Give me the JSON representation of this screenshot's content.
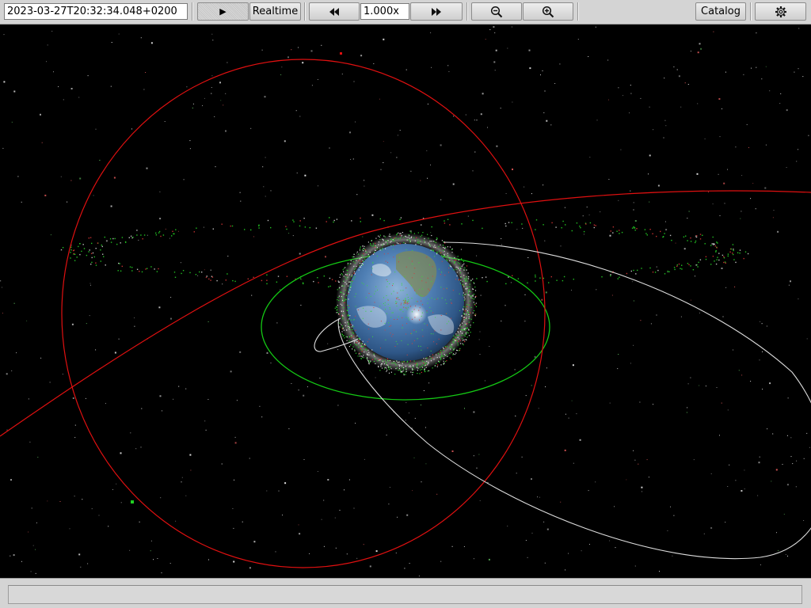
{
  "toolbar": {
    "datetime_value": "2023-03-27T20:32:34.048+0200",
    "play_label": "▶",
    "realtime_label": "Realtime",
    "speed_value": "1.000x",
    "catalog_label": "Catalog"
  },
  "icons": {
    "play": "play-icon",
    "rewind": "rewind-icon",
    "fast_forward": "fast-forward-icon",
    "zoom_out": "zoom-out-icon",
    "zoom_in": "zoom-in-icon",
    "settings": "settings-gear-icon"
  },
  "scene": {
    "background_color": "#000000",
    "earth_color": "#3f6fa8",
    "debris_color": "#c8c8c8",
    "satellite_color": "#22d022",
    "orbit_colors": {
      "highlighted_red": "#e01010",
      "selected_green": "#14c814",
      "transfer_white": "#dcdcdc"
    }
  },
  "statusbar": {
    "text": ""
  }
}
